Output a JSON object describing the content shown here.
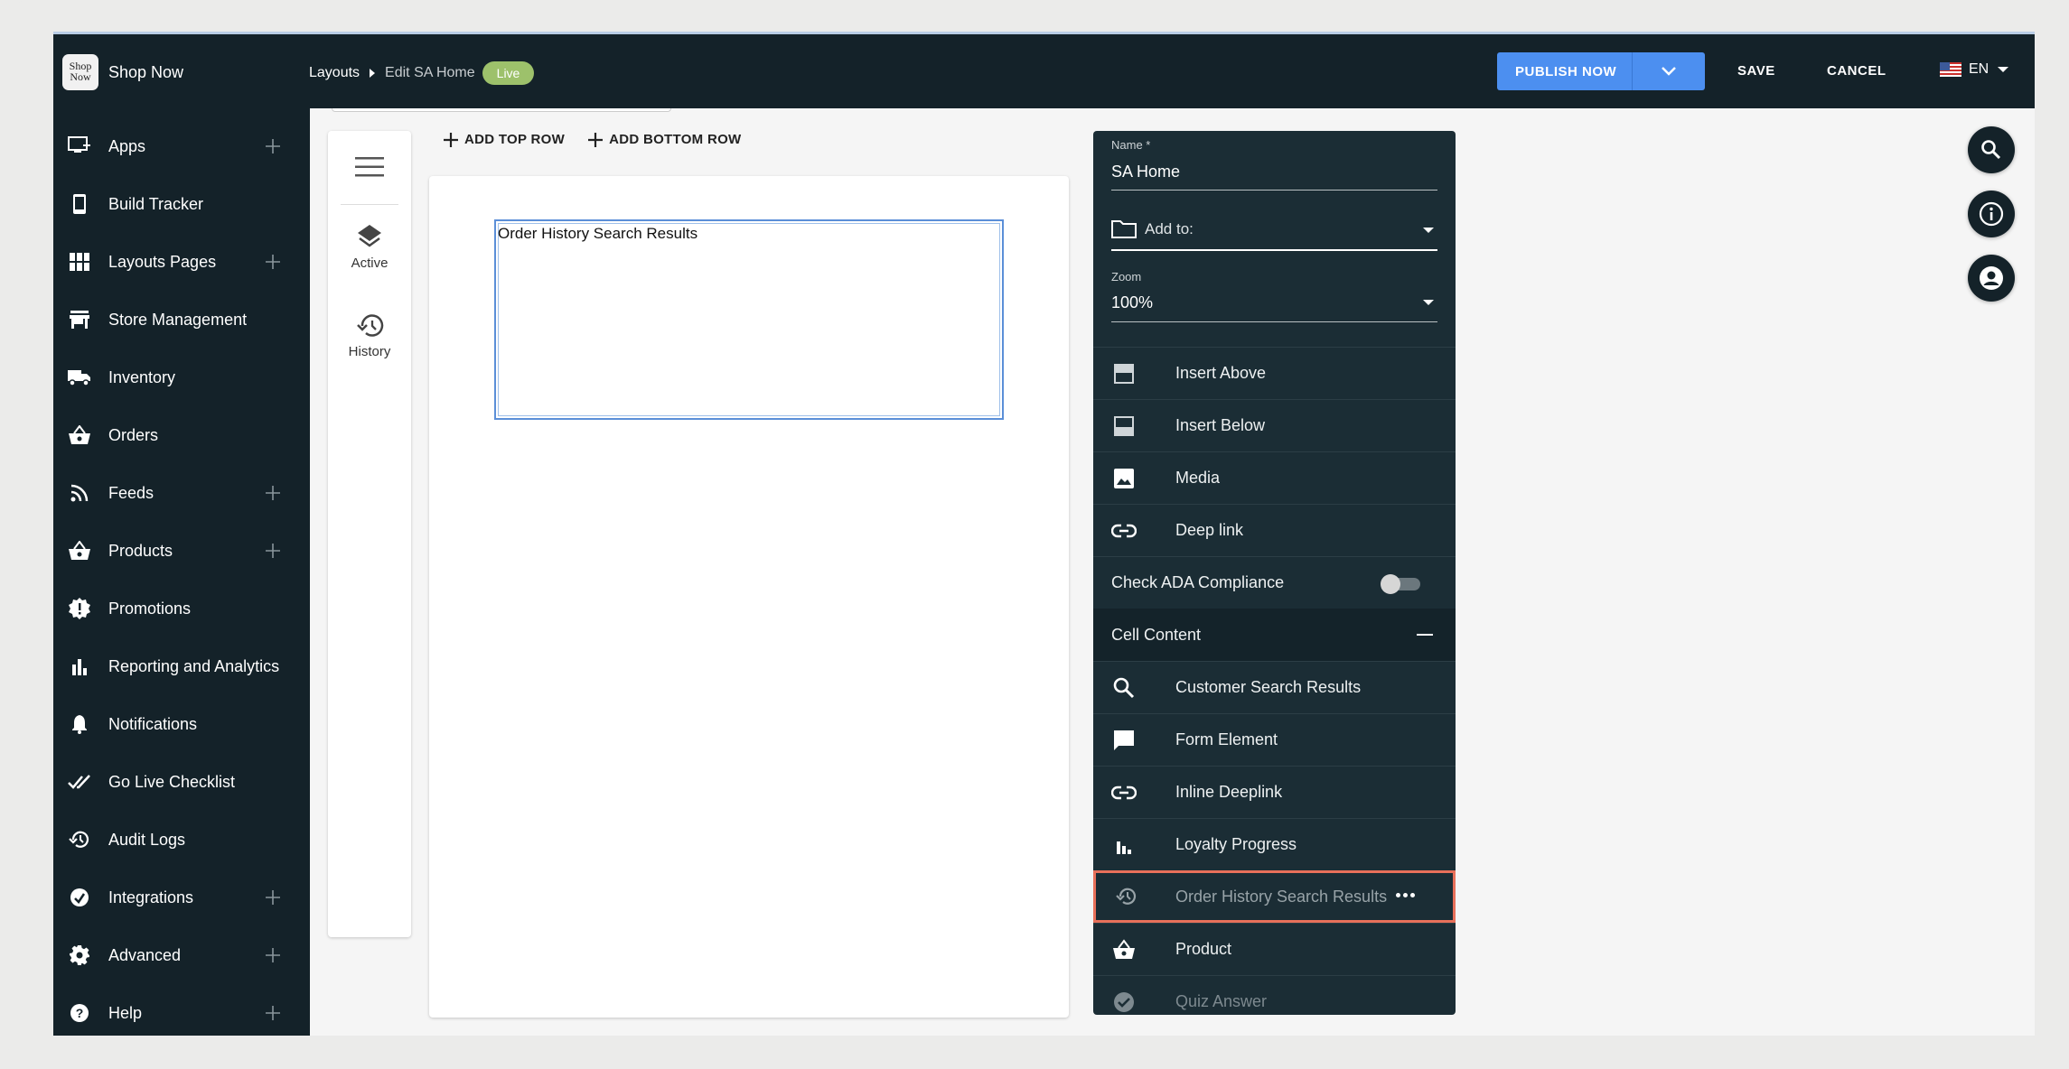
{
  "brand": {
    "logo_text": "Shop Now",
    "name": "Shop Now"
  },
  "breadcrumb": {
    "root": "Layouts",
    "current": "Edit SA Home",
    "badge": "Live"
  },
  "toolbar": {
    "publish": "PUBLISH NOW",
    "save": "SAVE",
    "cancel": "CANCEL",
    "language": "EN"
  },
  "sidebar": {
    "items": [
      {
        "label": "Apps",
        "icon": "apps-icon",
        "expandable": true
      },
      {
        "label": "Build Tracker",
        "icon": "phone-icon",
        "expandable": false
      },
      {
        "label": "Layouts Pages",
        "icon": "grid-icon",
        "expandable": true
      },
      {
        "label": "Store Management",
        "icon": "store-icon",
        "expandable": false
      },
      {
        "label": "Inventory",
        "icon": "truck-icon",
        "expandable": false
      },
      {
        "label": "Orders",
        "icon": "basket-icon",
        "expandable": false
      },
      {
        "label": "Feeds",
        "icon": "rss-icon",
        "expandable": true
      },
      {
        "label": "Products",
        "icon": "basket-icon",
        "expandable": true
      },
      {
        "label": "Promotions",
        "icon": "badge-icon",
        "expandable": false
      },
      {
        "label": "Reporting and Analytics",
        "icon": "bar-chart-icon",
        "expandable": false
      },
      {
        "label": "Notifications",
        "icon": "bell-icon",
        "expandable": false
      },
      {
        "label": "Go Live Checklist",
        "icon": "double-check-icon",
        "expandable": false
      },
      {
        "label": "Audit Logs",
        "icon": "history-icon",
        "expandable": false
      },
      {
        "label": "Integrations",
        "icon": "integrations-icon",
        "expandable": true
      },
      {
        "label": "Advanced",
        "icon": "gear-icon",
        "expandable": true
      },
      {
        "label": "Help",
        "icon": "help-icon",
        "expandable": true
      }
    ]
  },
  "rail": {
    "active": "Active",
    "history": "History"
  },
  "canvas_actions": {
    "add_top": "ADD TOP ROW",
    "add_bottom": "ADD BOTTOM ROW"
  },
  "canvas": {
    "cell_text": "Order History Search Results"
  },
  "props": {
    "name_label": "Name *",
    "name_value": "SA Home",
    "add_to_placeholder": "Add to:",
    "zoom_label": "Zoom",
    "zoom_value": "100%",
    "rows": [
      {
        "label": "Insert Above",
        "icon": "insert-above-icon"
      },
      {
        "label": "Insert Below",
        "icon": "insert-below-icon"
      },
      {
        "label": "Media",
        "icon": "image-icon"
      },
      {
        "label": "Deep link",
        "icon": "link-icon"
      }
    ],
    "ada_label": "Check ADA Compliance",
    "ada_enabled": false,
    "cell_content_header": "Cell Content",
    "cell_content": [
      {
        "label": "Customer Search Results",
        "icon": "search-icon"
      },
      {
        "label": "Form Element",
        "icon": "comment-icon"
      },
      {
        "label": "Inline Deeplink",
        "icon": "link-icon"
      },
      {
        "label": "Loyalty Progress",
        "icon": "bar-chart-icon"
      },
      {
        "label": "Order History Search Results",
        "icon": "history-icon"
      },
      {
        "label": "Product",
        "icon": "basket-icon"
      },
      {
        "label": "Quiz Answer",
        "icon": "check-circle-icon"
      }
    ]
  },
  "colors": {
    "sidebar_bg": "#142229",
    "panel_bg": "#1b2d35",
    "publish": "#4c8ff0",
    "live_badge": "#9dc16b",
    "highlight": "#e8705a"
  }
}
